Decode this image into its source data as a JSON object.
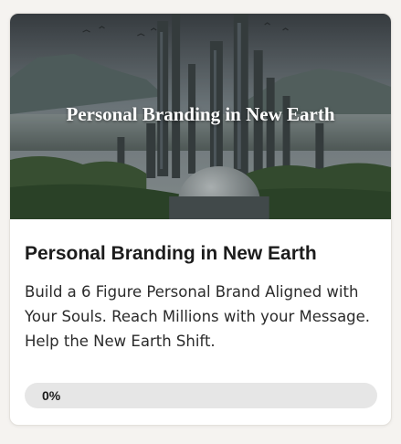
{
  "course": {
    "image_title": "Personal Branding in New Earth",
    "title": "Personal Branding in New Earth",
    "description": "Build a 6 Figure Personal Brand Aligned with Your Souls. Reach Millions with your Message. Help the New Earth Shift.",
    "progress_label": "0%",
    "progress_fraction": 0
  }
}
